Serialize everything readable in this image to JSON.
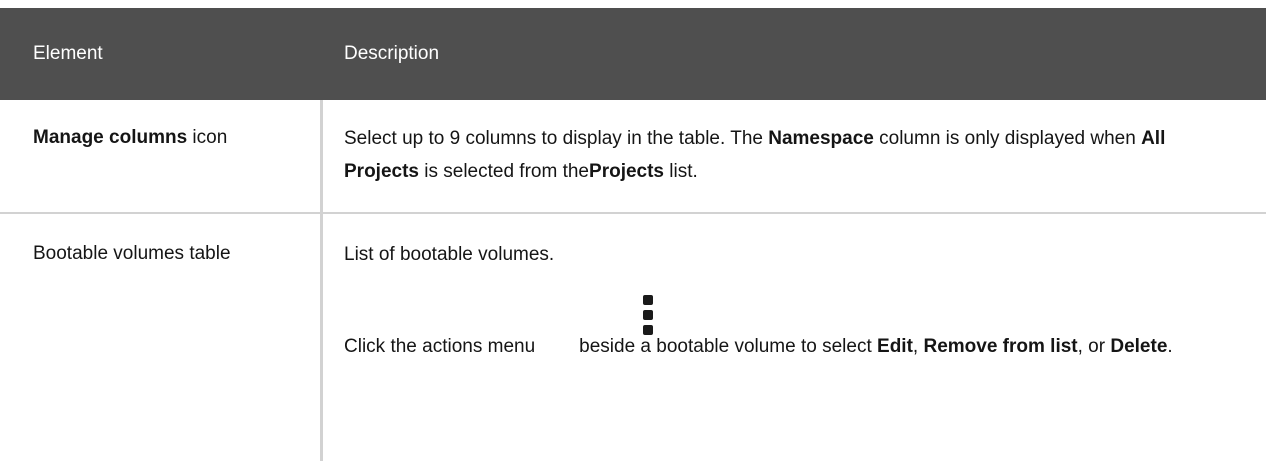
{
  "table": {
    "headers": {
      "element": "Element",
      "description": "Description"
    },
    "rows": [
      {
        "element_bold": "Manage columns",
        "element_suffix": " icon",
        "desc": {
          "t1": "Select up to 9 columns to display in the table. The ",
          "b1": "Namespace",
          "t2": " column is only displayed when ",
          "b2": "All Projects",
          "t3": " is selected from the",
          "b3": "Projects",
          "t4": " list."
        }
      },
      {
        "element": "Bootable volumes table",
        "desc": {
          "p1": "List of bootable volumes.",
          "t1": "Click the actions menu",
          "icon": "kebab-menu-icon",
          "t2": "beside a bootable volume to select ",
          "b1": "Edit",
          "t3": ", ",
          "b2": "Remove from list",
          "t4": ", or ",
          "b3": "Delete",
          "t5": "."
        }
      }
    ]
  }
}
